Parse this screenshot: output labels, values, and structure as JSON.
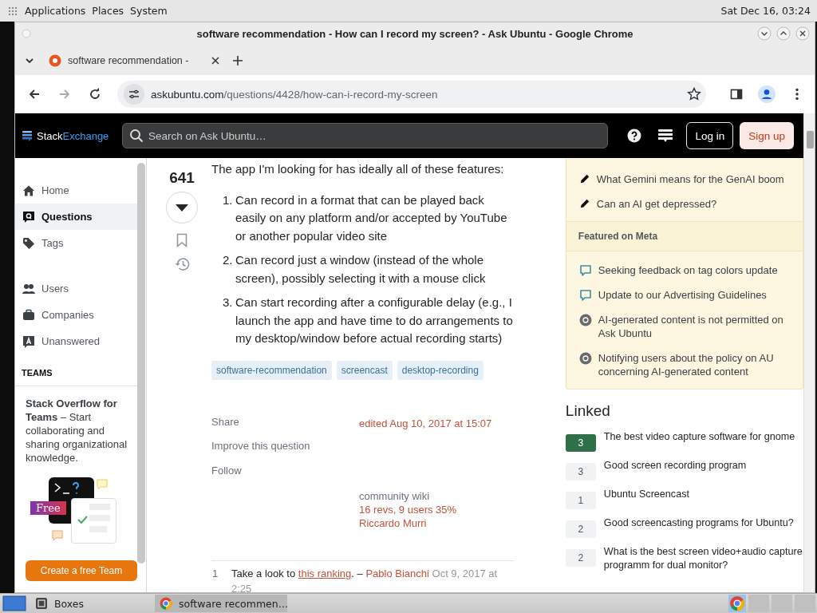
{
  "top_panel": {
    "menus": [
      "Applications",
      "Places",
      "System"
    ],
    "clock": "Sat Dec 16, 03:24"
  },
  "window": {
    "title": "software recommendation - How can I record my screen? - Ask Ubuntu - Google Chrome"
  },
  "tabs": [
    {
      "label": "software recommendation -",
      "selected": true
    }
  ],
  "address_bar": {
    "domain": "askubuntu.com",
    "path": "/questions/4428/how-can-i-record-my-screen"
  },
  "site_header": {
    "logo": [
      "Stack",
      "Exchange"
    ],
    "search": {
      "placeholder": "Search on Ask Ubuntu…"
    },
    "login": "Log in",
    "signup": "Sign up"
  },
  "nav": {
    "items": [
      {
        "kind": "home",
        "label": "Home",
        "selected": false
      },
      {
        "kind": "questions",
        "label": "Questions",
        "selected": true
      },
      {
        "kind": "tags",
        "label": "Tags",
        "selected": false
      },
      {
        "kind": "users",
        "label": "Users",
        "selected": false
      },
      {
        "kind": "companies",
        "label": "Companies",
        "selected": false
      },
      {
        "kind": "unanswered",
        "label": "Unanswered",
        "selected": false
      }
    ],
    "teams_heading": "TEAMS",
    "teams_promo": "**Stack Overflow for Teams** – Start collaborating and sharing organizational knowledge.",
    "free_badge": "Free",
    "cta": "Create a free Team"
  },
  "question": {
    "score": "641",
    "intro": "The app I'm looking for has ideally all of these features:",
    "features": [
      {
        "number": "1.",
        "text": "Can record in a format that can be played back easily on any platform and/or accepted by YouTube or another popular video site"
      },
      {
        "number": "2.",
        "text": "Can record just a window (instead of the whole screen), possibly selecting it with a mouse click"
      },
      {
        "number": "3.",
        "text": "Can start recording after a configurable delay (e.g., I launch the app and have time to do arrangements to my desktop/window before actual recording starts)"
      }
    ],
    "tags": [
      "software-recommendation",
      "screencast",
      "desktop-recording"
    ],
    "actions": [
      "Share",
      "Improve this question",
      "Follow"
    ],
    "edited": "edited Aug 10, 2017 at 15:07",
    "wiki": {
      "label": "community wiki",
      "revisions": "16 revs, 9 users 35%",
      "author": "Riccardo Murri"
    },
    "comments": [
      {
        "score": "1",
        "before": "Take a look to ",
        "link": "this ranking",
        "after": ". – ",
        "author": "Pablo Bianchi",
        "date": "Oct 9, 2017 at 2:25"
      }
    ]
  },
  "sidebar": {
    "blog_items": [
      "What Gemini means for the GenAI boom",
      "Can an AI get depressed?"
    ],
    "meta_heading": "Featured on Meta",
    "meta_items": [
      {
        "kind": "chat",
        "text": "Seeking feedback on tag colors update"
      },
      {
        "kind": "chat",
        "text": "Update to our Advertising Guidelines"
      },
      {
        "kind": "site",
        "text": "AI-generated content is not permitted on Ask Ubuntu"
      },
      {
        "kind": "site",
        "text": "Notifying users about the policy on AU concerning AI-generated content"
      }
    ],
    "linked_heading": "Linked",
    "linked": [
      {
        "count": "3",
        "accepted": true,
        "title": "The best video capture software for gnome"
      },
      {
        "count": "3",
        "accepted": false,
        "title": "Good screen recording program"
      },
      {
        "count": "1",
        "accepted": false,
        "title": "Ubuntu Screencast"
      },
      {
        "count": "2",
        "accepted": false,
        "title": "Good screencasting programs for Ubuntu?"
      },
      {
        "count": "2",
        "accepted": false,
        "title": "What is the best screen video+audio capture programm for dual monitor?"
      }
    ]
  },
  "taskbar": {
    "items": [
      {
        "kind": "boxes",
        "label": "Boxes",
        "selected": false
      },
      {
        "kind": "browser",
        "label": "software recommen…",
        "selected": true
      }
    ]
  }
}
